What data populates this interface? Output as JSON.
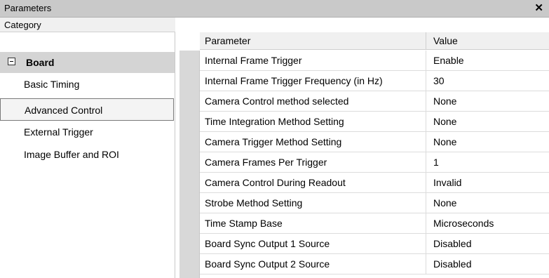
{
  "window": {
    "title": "Parameters",
    "close_glyph": "✕"
  },
  "category": {
    "header": "Category",
    "group_label": "Board",
    "group_icon": "collapse-minus-icon",
    "items": [
      {
        "label": "Basic Timing",
        "selected": false
      },
      {
        "label": "Advanced Control",
        "selected": true
      },
      {
        "label": "External Trigger",
        "selected": false
      },
      {
        "label": "Image Buffer and ROI",
        "selected": false
      }
    ]
  },
  "grid": {
    "columns": [
      "Parameter",
      "Value"
    ],
    "rows": [
      {
        "parameter": "Internal Frame Trigger",
        "value": "Enable"
      },
      {
        "parameter": "Internal Frame Trigger Frequency (in Hz)",
        "value": "30"
      },
      {
        "parameter": "Camera Control method selected",
        "value": "None"
      },
      {
        "parameter": "Time Integration Method Setting",
        "value": "None"
      },
      {
        "parameter": "Camera Trigger Method Setting",
        "value": "None"
      },
      {
        "parameter": "Camera Frames Per Trigger",
        "value": "1"
      },
      {
        "parameter": "Camera Control During Readout",
        "value": "Invalid"
      },
      {
        "parameter": "Strobe Method Setting",
        "value": "None"
      },
      {
        "parameter": "Time Stamp Base",
        "value": "Microseconds"
      },
      {
        "parameter": "Board Sync Output 1 Source",
        "value": "Disabled"
      },
      {
        "parameter": "Board Sync Output 2 Source",
        "value": "Disabled"
      }
    ]
  }
}
